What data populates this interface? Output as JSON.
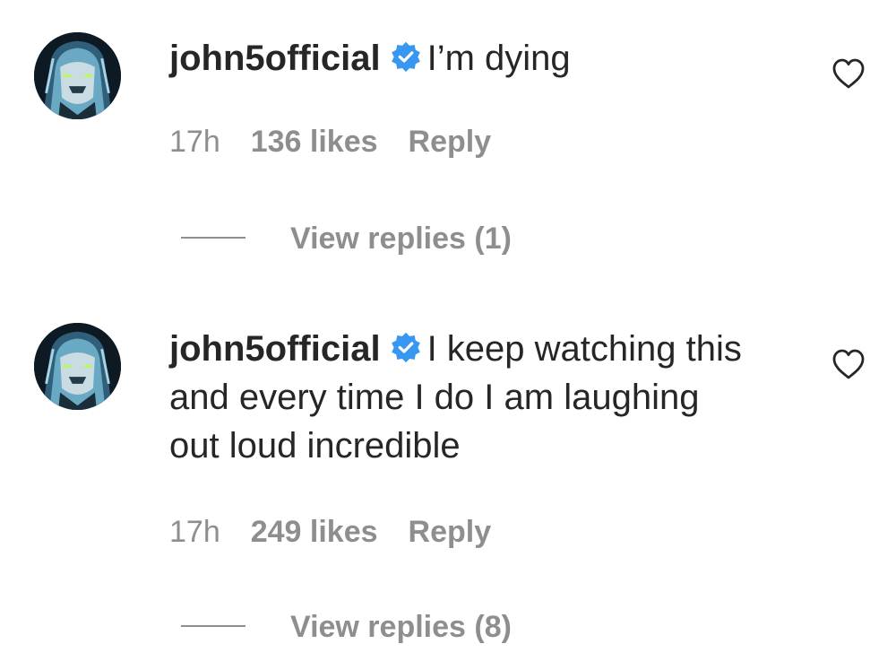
{
  "colors": {
    "text": "#262626",
    "meta": "#8e8e8e",
    "verified": "#3897f0",
    "background": "#ffffff"
  },
  "comments": [
    {
      "username": "john5official",
      "verified_icon": "verified-badge-icon",
      "text": "I’m dying",
      "time": "17h",
      "likes": "136 likes",
      "reply_label": "Reply",
      "view_replies": "View replies (1)"
    },
    {
      "username": "john5official",
      "verified_icon": "verified-badge-icon",
      "text": "I keep watching this and every time I do I am laughing out loud incredible",
      "time": "17h",
      "likes": "249 likes",
      "reply_label": "Reply",
      "view_replies": "View replies (8)"
    }
  ]
}
